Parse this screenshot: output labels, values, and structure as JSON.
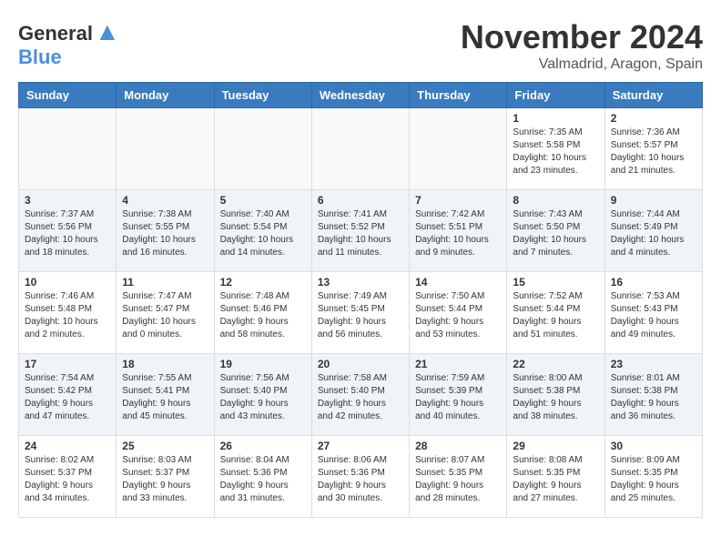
{
  "header": {
    "logo_line1": "General",
    "logo_line2": "Blue",
    "title": "November 2024",
    "subtitle": "Valmadrid, Aragon, Spain"
  },
  "weekdays": [
    "Sunday",
    "Monday",
    "Tuesday",
    "Wednesday",
    "Thursday",
    "Friday",
    "Saturday"
  ],
  "weeks": [
    [
      {
        "day": "",
        "info": ""
      },
      {
        "day": "",
        "info": ""
      },
      {
        "day": "",
        "info": ""
      },
      {
        "day": "",
        "info": ""
      },
      {
        "day": "",
        "info": ""
      },
      {
        "day": "1",
        "info": "Sunrise: 7:35 AM\nSunset: 5:58 PM\nDaylight: 10 hours\nand 23 minutes."
      },
      {
        "day": "2",
        "info": "Sunrise: 7:36 AM\nSunset: 5:57 PM\nDaylight: 10 hours\nand 21 minutes."
      }
    ],
    [
      {
        "day": "3",
        "info": "Sunrise: 7:37 AM\nSunset: 5:56 PM\nDaylight: 10 hours\nand 18 minutes."
      },
      {
        "day": "4",
        "info": "Sunrise: 7:38 AM\nSunset: 5:55 PM\nDaylight: 10 hours\nand 16 minutes."
      },
      {
        "day": "5",
        "info": "Sunrise: 7:40 AM\nSunset: 5:54 PM\nDaylight: 10 hours\nand 14 minutes."
      },
      {
        "day": "6",
        "info": "Sunrise: 7:41 AM\nSunset: 5:52 PM\nDaylight: 10 hours\nand 11 minutes."
      },
      {
        "day": "7",
        "info": "Sunrise: 7:42 AM\nSunset: 5:51 PM\nDaylight: 10 hours\nand 9 minutes."
      },
      {
        "day": "8",
        "info": "Sunrise: 7:43 AM\nSunset: 5:50 PM\nDaylight: 10 hours\nand 7 minutes."
      },
      {
        "day": "9",
        "info": "Sunrise: 7:44 AM\nSunset: 5:49 PM\nDaylight: 10 hours\nand 4 minutes."
      }
    ],
    [
      {
        "day": "10",
        "info": "Sunrise: 7:46 AM\nSunset: 5:48 PM\nDaylight: 10 hours\nand 2 minutes."
      },
      {
        "day": "11",
        "info": "Sunrise: 7:47 AM\nSunset: 5:47 PM\nDaylight: 10 hours\nand 0 minutes."
      },
      {
        "day": "12",
        "info": "Sunrise: 7:48 AM\nSunset: 5:46 PM\nDaylight: 9 hours\nand 58 minutes."
      },
      {
        "day": "13",
        "info": "Sunrise: 7:49 AM\nSunset: 5:45 PM\nDaylight: 9 hours\nand 56 minutes."
      },
      {
        "day": "14",
        "info": "Sunrise: 7:50 AM\nSunset: 5:44 PM\nDaylight: 9 hours\nand 53 minutes."
      },
      {
        "day": "15",
        "info": "Sunrise: 7:52 AM\nSunset: 5:44 PM\nDaylight: 9 hours\nand 51 minutes."
      },
      {
        "day": "16",
        "info": "Sunrise: 7:53 AM\nSunset: 5:43 PM\nDaylight: 9 hours\nand 49 minutes."
      }
    ],
    [
      {
        "day": "17",
        "info": "Sunrise: 7:54 AM\nSunset: 5:42 PM\nDaylight: 9 hours\nand 47 minutes."
      },
      {
        "day": "18",
        "info": "Sunrise: 7:55 AM\nSunset: 5:41 PM\nDaylight: 9 hours\nand 45 minutes."
      },
      {
        "day": "19",
        "info": "Sunrise: 7:56 AM\nSunset: 5:40 PM\nDaylight: 9 hours\nand 43 minutes."
      },
      {
        "day": "20",
        "info": "Sunrise: 7:58 AM\nSunset: 5:40 PM\nDaylight: 9 hours\nand 42 minutes."
      },
      {
        "day": "21",
        "info": "Sunrise: 7:59 AM\nSunset: 5:39 PM\nDaylight: 9 hours\nand 40 minutes."
      },
      {
        "day": "22",
        "info": "Sunrise: 8:00 AM\nSunset: 5:38 PM\nDaylight: 9 hours\nand 38 minutes."
      },
      {
        "day": "23",
        "info": "Sunrise: 8:01 AM\nSunset: 5:38 PM\nDaylight: 9 hours\nand 36 minutes."
      }
    ],
    [
      {
        "day": "24",
        "info": "Sunrise: 8:02 AM\nSunset: 5:37 PM\nDaylight: 9 hours\nand 34 minutes."
      },
      {
        "day": "25",
        "info": "Sunrise: 8:03 AM\nSunset: 5:37 PM\nDaylight: 9 hours\nand 33 minutes."
      },
      {
        "day": "26",
        "info": "Sunrise: 8:04 AM\nSunset: 5:36 PM\nDaylight: 9 hours\nand 31 minutes."
      },
      {
        "day": "27",
        "info": "Sunrise: 8:06 AM\nSunset: 5:36 PM\nDaylight: 9 hours\nand 30 minutes."
      },
      {
        "day": "28",
        "info": "Sunrise: 8:07 AM\nSunset: 5:35 PM\nDaylight: 9 hours\nand 28 minutes."
      },
      {
        "day": "29",
        "info": "Sunrise: 8:08 AM\nSunset: 5:35 PM\nDaylight: 9 hours\nand 27 minutes."
      },
      {
        "day": "30",
        "info": "Sunrise: 8:09 AM\nSunset: 5:35 PM\nDaylight: 9 hours\nand 25 minutes."
      }
    ]
  ]
}
